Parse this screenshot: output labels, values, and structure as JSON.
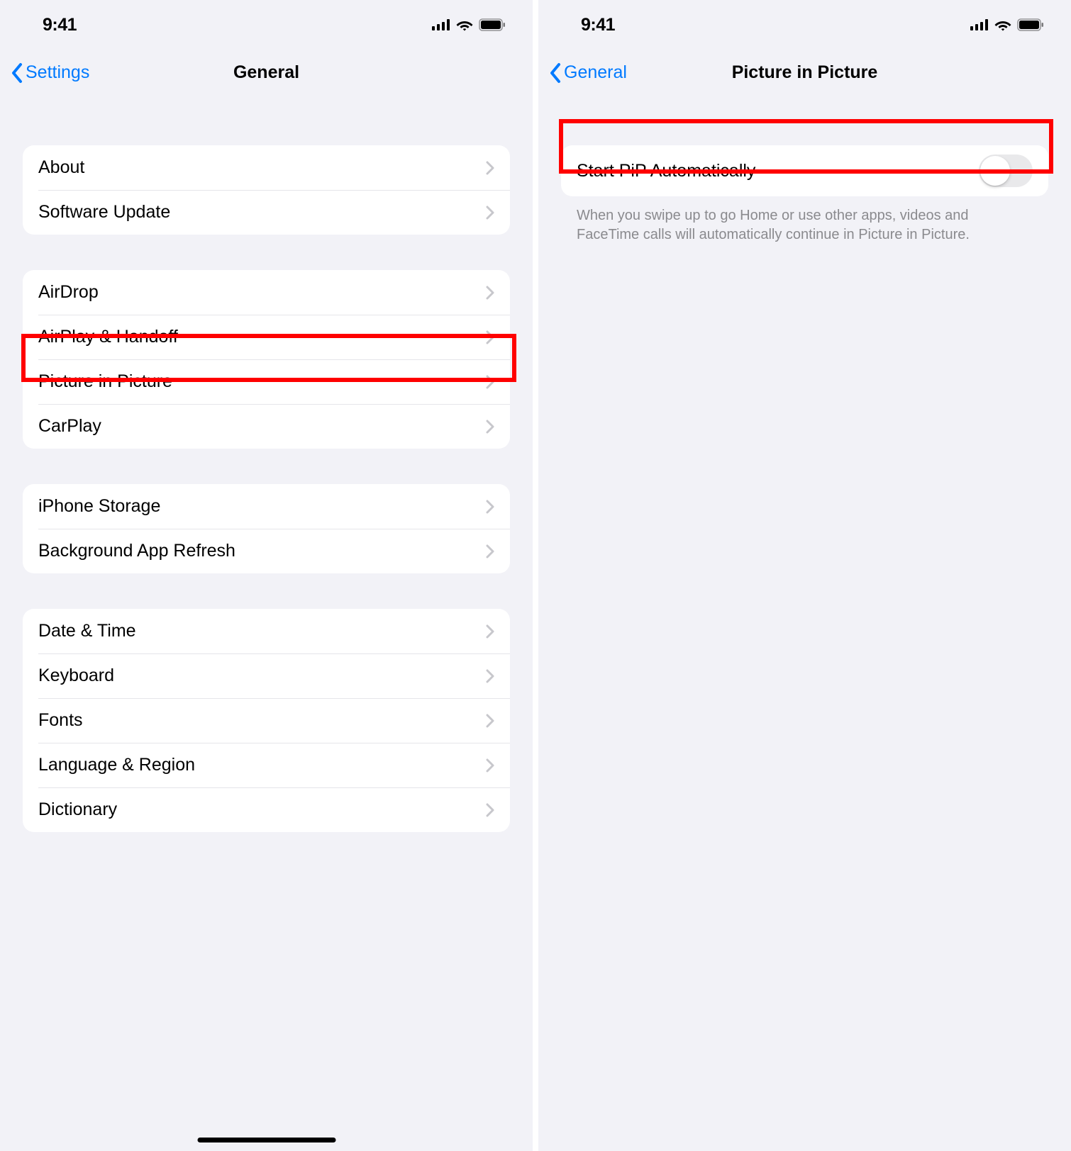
{
  "status": {
    "time": "9:41"
  },
  "left": {
    "back_label": "Settings",
    "title": "General",
    "groups": [
      {
        "rows": [
          "About",
          "Software Update"
        ]
      },
      {
        "rows": [
          "AirDrop",
          "AirPlay & Handoff",
          "Picture in Picture",
          "CarPlay"
        ],
        "highlight_index": 2
      },
      {
        "rows": [
          "iPhone Storage",
          "Background App Refresh"
        ]
      },
      {
        "rows": [
          "Date & Time",
          "Keyboard",
          "Fonts",
          "Language & Region",
          "Dictionary"
        ]
      }
    ]
  },
  "right": {
    "back_label": "General",
    "title": "Picture in Picture",
    "toggle_label": "Start PiP Automatically",
    "toggle_on": false,
    "footer": "When you swipe up to go Home or use other apps, videos and FaceTime calls will automatically continue in Picture in Picture."
  }
}
